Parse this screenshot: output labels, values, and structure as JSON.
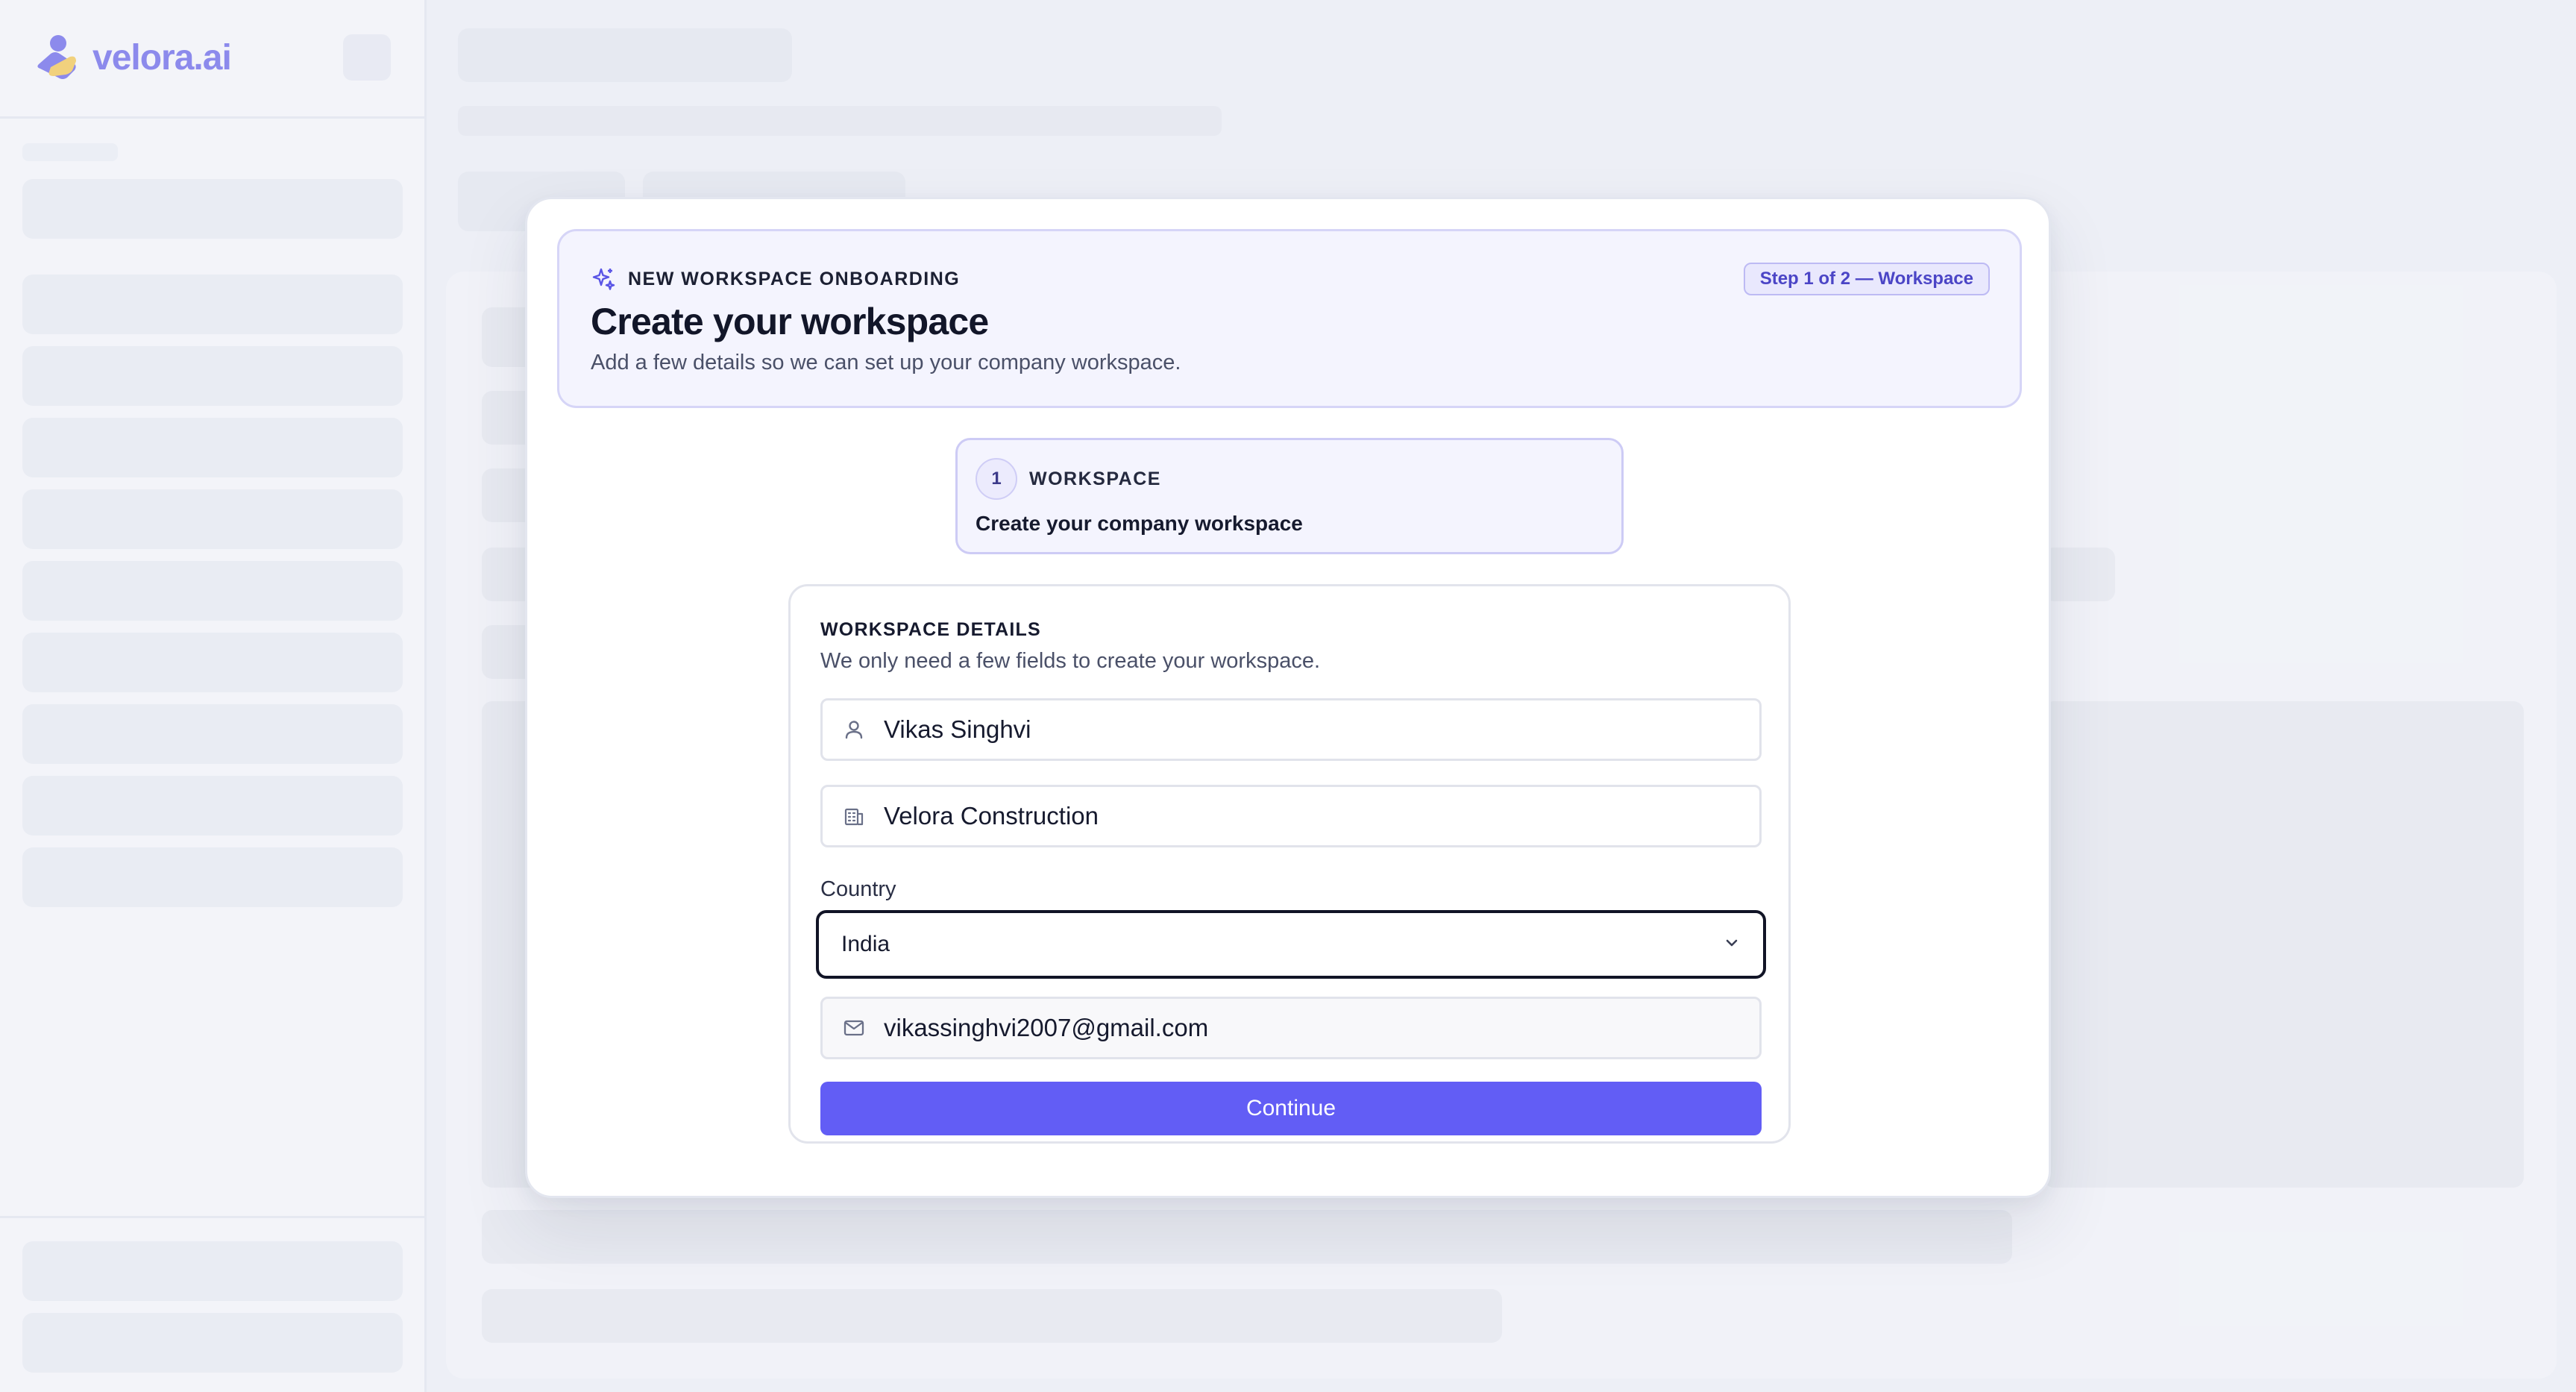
{
  "brand": {
    "name": "velora.ai",
    "accent": "#5a55e6"
  },
  "header": {
    "eyebrow": "NEW WORKSPACE ONBOARDING",
    "title": "Create your workspace",
    "subtitle": "Add a few details so we can set up your company workspace.",
    "step_badge": "Step 1 of 2 — Workspace"
  },
  "step": {
    "number": "1",
    "label": "WORKSPACE",
    "description": "Create your company workspace"
  },
  "form": {
    "title": "WORKSPACE DETAILS",
    "subtitle": "We only need a few fields to create your workspace.",
    "name_value": "Vikas Singhvi",
    "name_icon": "user-icon",
    "company_value": "Velora Construction",
    "company_icon": "building-icon",
    "country_label": "Country",
    "country_value": "India",
    "email_value": "vikassinghvi2007@gmail.com",
    "email_icon": "mail-icon",
    "continue_label": "Continue"
  },
  "colors": {
    "primary": "#625df5",
    "accent_soft": "#f4f4fe",
    "badge_text": "#4b45c6"
  }
}
